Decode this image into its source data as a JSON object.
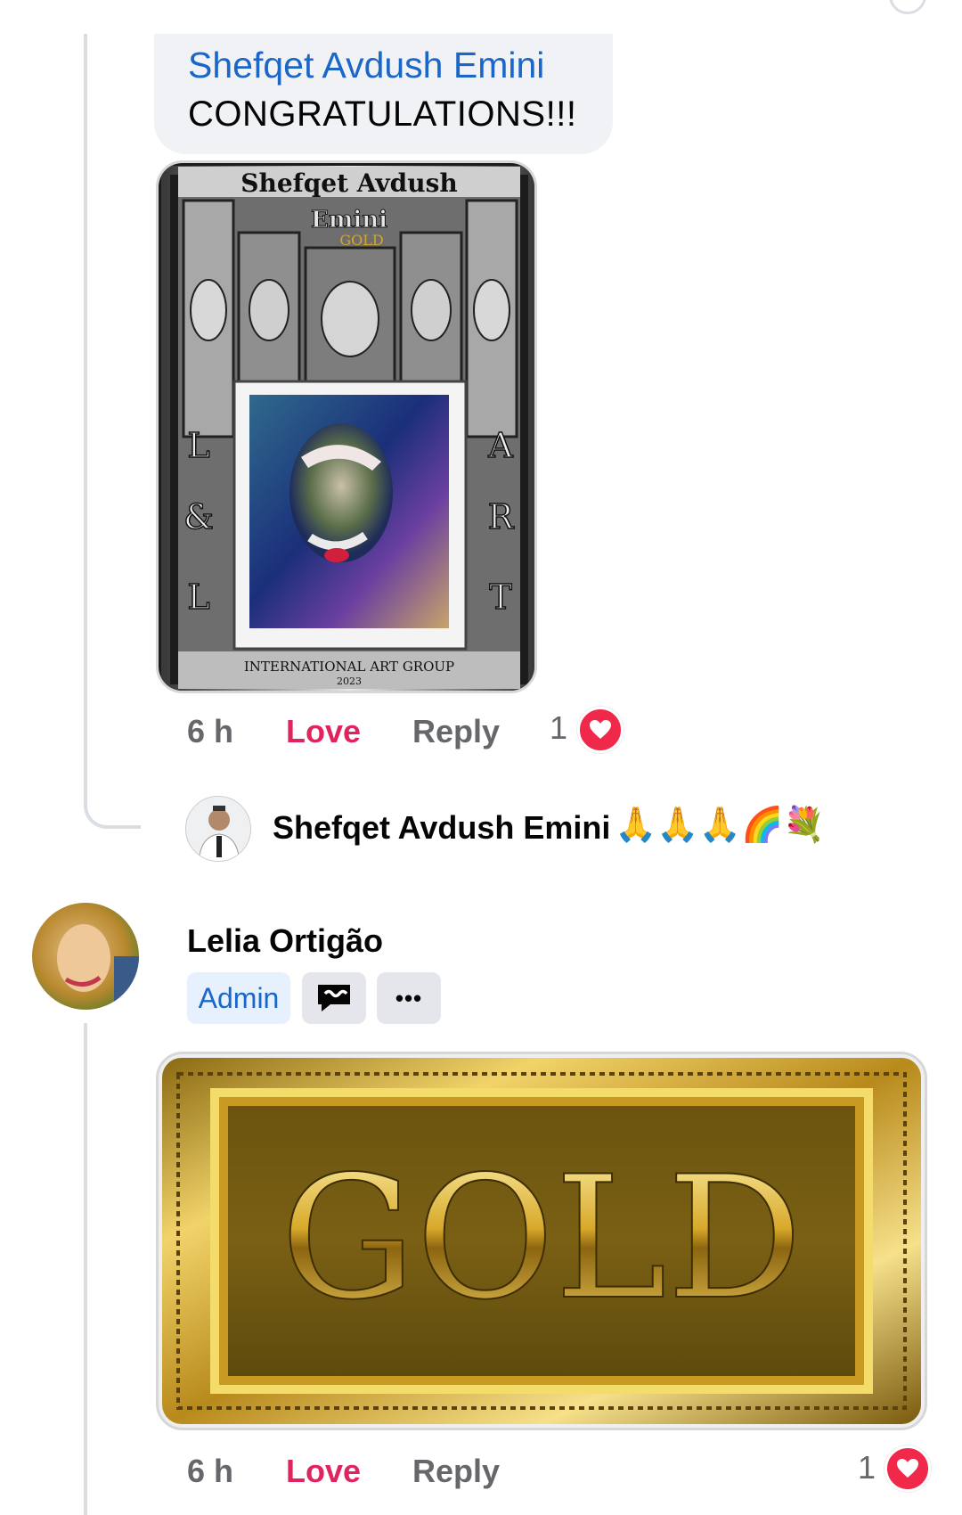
{
  "comment_1": {
    "author": "Shefqet Avdush Emini",
    "text": "CONGRATULATIONS!!!",
    "image": {
      "title_line1": "Shefqet Avdush",
      "title_line2": "Emini",
      "title_line3": "GOLD",
      "left_letters": [
        "L",
        "&",
        "L"
      ],
      "right_letters": [
        "A",
        "R",
        "T"
      ],
      "footer": "INTERNATIONAL ART GROUP",
      "footer_year": "2023"
    },
    "actions": {
      "time": "6 h",
      "love": "Love",
      "reply": "Reply",
      "reaction_count": "1"
    }
  },
  "reply_preview": {
    "author": "Shefqet Avdush Emini",
    "emojis": "🙏🙏🙏🌈💐"
  },
  "comment_2": {
    "author": "Lelia Ortigão",
    "badge": "Admin",
    "more_label": "•••",
    "image": {
      "text": "GOLD"
    },
    "actions": {
      "time": "6 h",
      "love": "Love",
      "reply": "Reply",
      "reaction_count": "1"
    }
  },
  "icons": {
    "heart": "heart-icon",
    "more": "more-icon",
    "messenger": "chat-bubble-icon"
  },
  "colors": {
    "link_blue": "#1a66c9",
    "love_red": "#e0245e",
    "heart_red": "#f02849",
    "meta_grey": "#65676b",
    "gold": "#d4a62a"
  }
}
